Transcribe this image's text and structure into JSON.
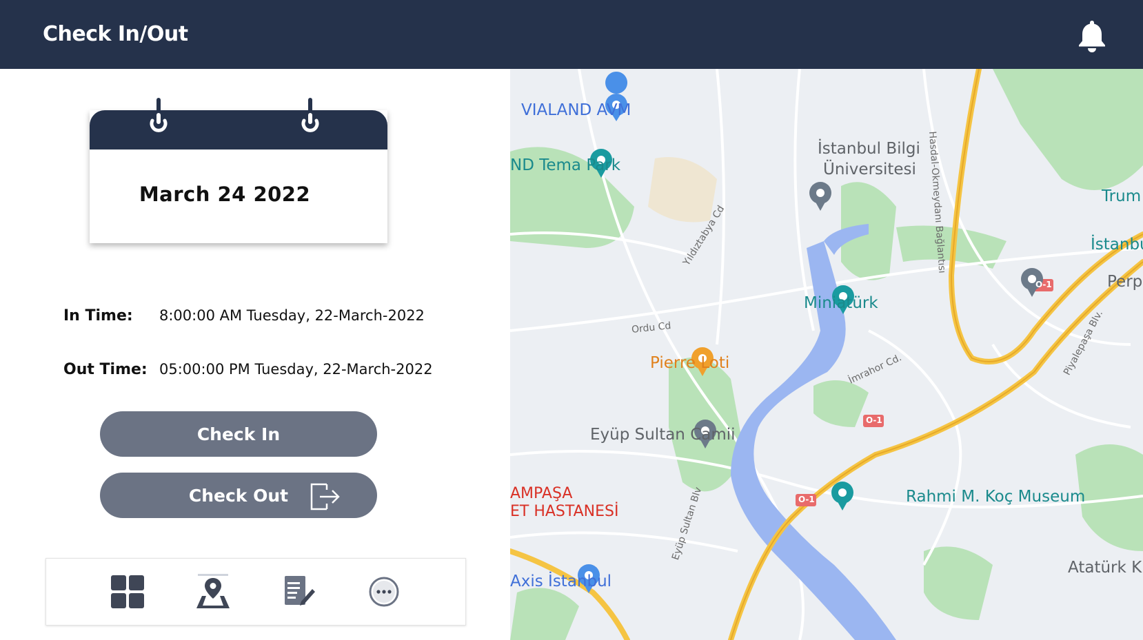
{
  "header": {
    "title": "Check In/Out"
  },
  "calendar": {
    "date": "March 24 2022"
  },
  "times": {
    "in_label": "In Time:",
    "in_value": "8:00:00 AM Tuesday, 22-March-2022",
    "out_label": "Out Time:",
    "out_value": "05:00:00 PM Tuesday, 22-March-2022"
  },
  "actions": {
    "check_in": "Check In",
    "check_out": "Check Out"
  },
  "nav": {
    "icons": [
      "dashboard-icon",
      "map-location-icon",
      "edit-notes-icon",
      "more-options-icon"
    ]
  },
  "map": {
    "labels": {
      "vialand": "VIALAND AVM",
      "tema_park": "ND Tema Park",
      "bilgi_1": "İstanbul Bilgi",
      "bilgi_2": "Üniversitesi",
      "trump": "Trum",
      "istanbu": "İstanbu",
      "perpa": "Perp",
      "miniaturk": "Miniatürk",
      "pierre_loti": "Pierre Loti",
      "eyup": "Eyüp Sultan Camii",
      "hastane_1": "AMPAŞA",
      "hastane_2": "ET HASTANESİ",
      "rahmi": "Rahmi M. Koç Museum",
      "axis": "Axis İstanbul",
      "ataturk": "Atatürk K",
      "yildiztabya": "Yıldıztabya Cd",
      "ordu": "Ordu Cd",
      "imrahor": "İmrahor Cd.",
      "hasdal": "Hasdal-Okmeydanı Bağlantısı",
      "piyalepasa": "Piyalepaşa Blv.",
      "eyup_blv": "Eyüp Sultan Blv",
      "highway": "O-1"
    },
    "colors": {
      "water": "#9bb6f1",
      "park": "#b9e2b8",
      "highway": "#f5c443",
      "land": "#eceff3"
    }
  }
}
